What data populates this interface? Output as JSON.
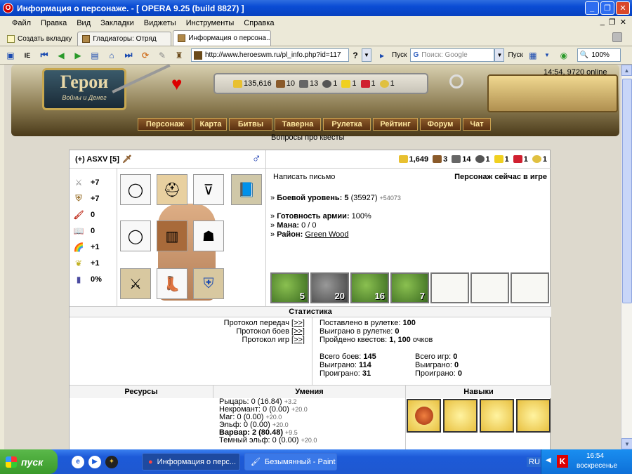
{
  "window": {
    "title": "Информация о персонаже. - [ OPERA 9.25 (build 8827) ]"
  },
  "menu": {
    "items": [
      "Файл",
      "Правка",
      "Вид",
      "Закладки",
      "Виджеты",
      "Инструменты",
      "Справка"
    ]
  },
  "tabs": {
    "new_tab": "Создать вкладку",
    "items": [
      "Гладиаторы: Отряд",
      "Информация о персона..."
    ]
  },
  "toolbar": {
    "url": "http://www.heroeswm.ru/pl_info.php?id=117",
    "go_label": "Пуск",
    "search_placeholder": "Поиск: Google",
    "search_go": "Пуск",
    "zoom": "100%"
  },
  "site": {
    "logo_title": "Герои",
    "logo_subtitle": "Войны и Денег",
    "time_online": "14:54, 9720 online",
    "resources": {
      "gold": "135,616",
      "wood": "10",
      "ore": "13",
      "mercury": "1",
      "sulfur": "1",
      "crystal": "1",
      "gems": "1"
    },
    "nav": [
      "Персонаж",
      "Карта",
      "Битвы",
      "Таверна",
      "Рулетка",
      "Рейтинг",
      "Форум",
      "Чат"
    ],
    "quest_link": "Вопросы про квесты"
  },
  "character": {
    "name": "(+) ASXV  [5]",
    "resources": {
      "gold": "1,649",
      "wood": "3",
      "ore": "14",
      "mercury": "1",
      "sulfur": "1",
      "crystal": "1",
      "gems": "1"
    },
    "stats": {
      "attack": "+7",
      "defense": "+7",
      "spell_power": "0",
      "knowledge": "0",
      "luck": "+1",
      "morale": "+1",
      "initiative": "0%"
    },
    "write_letter": "Написать письмо",
    "status": "Персонаж сейчас в игре",
    "combat_level_label": "Боевой уровень:",
    "combat_level": "5",
    "combat_exp": "(35927)",
    "exp_next": "+54073",
    "army_ready_label": "Готовность армии:",
    "army_ready": "100%",
    "mana_label": "Мана:",
    "mana": "0 / 0",
    "district_label": "Район:",
    "district": "Green Wood",
    "army": [
      "5",
      "20",
      "16",
      "7",
      "",
      "",
      ""
    ]
  },
  "statistics": {
    "title": "Статистика",
    "protocols": [
      "Протокол передач",
      "Протокол боев",
      "Протокол игр"
    ],
    "protocol_link": "[>>]",
    "roulette_bet": "Поставлено в рулетке: ",
    "roulette_bet_value": "100",
    "roulette_won": "Выиграно в рулетке: ",
    "roulette_won_value": "0",
    "quests_label": "Пройдено квестов: ",
    "quests_value": "1, 100",
    "quests_unit": " очков",
    "battles_total_label": "Всего боев: ",
    "battles_total": "145",
    "battles_won_label": "Выиграно: ",
    "battles_won": "114",
    "battles_lost_label": "Проиграно: ",
    "battles_lost": "31",
    "games_total_label": "Всего игр: ",
    "games_total": "0",
    "games_won_label": "Выиграно: ",
    "games_won": "0",
    "games_lost_label": "Проиграно: ",
    "games_lost": "0"
  },
  "bottom": {
    "resources_hdr": "Ресурсы",
    "skills_hdr": "Умения",
    "abilities_hdr": "Навыки",
    "skills": [
      {
        "name": "Рыцарь: 0 (16.84)",
        "inc": "+3.2"
      },
      {
        "name": "Некромант: 0 (0.00)",
        "inc": "+20.0"
      },
      {
        "name": "Маг: 0 (0.00)",
        "inc": "+20.0"
      },
      {
        "name": "Эльф: 0 (0.00)",
        "inc": "+20.0"
      },
      {
        "name": "Варвар: 2 (80.48)",
        "inc": "+9.5"
      },
      {
        "name": "Темный эльф: 0 (0.00)",
        "inc": "+20.0"
      }
    ]
  },
  "taskbar": {
    "start": "пуск",
    "tasks": [
      "Информация о перс...",
      "Безымянный - Paint"
    ],
    "lang": "RU",
    "time": "16:54",
    "day": "воскресенье"
  }
}
